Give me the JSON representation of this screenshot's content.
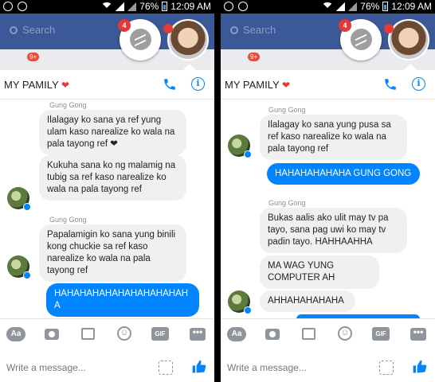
{
  "status": {
    "battery": "76%",
    "time": "12:09 AM"
  },
  "facebook": {
    "search_placeholder": "Search",
    "nav_badge": "9+"
  },
  "chatheads": {
    "messenger_badge": "4"
  },
  "header": {
    "title": "MY PAMILY",
    "heart": "❤"
  },
  "composer": {
    "placeholder": "Write a message...",
    "aa": "Aa",
    "gif": "GIF",
    "more": "•••"
  },
  "left": {
    "messages": [
      {
        "sender": "Gung Gong",
        "text": "Ilalagay ko sana ya ref yung ulam kaso narealize ko wala na pala tayong ref ❤"
      },
      {
        "text": "Kukuha sana ko ng malamig na tubig sa ref kaso narealize ko wala na pala tayong ref"
      },
      {
        "sender": "Gung Gong",
        "text": "Papalamigin ko sana yung binili kong chuckie sa ref kaso narealize ko wala na pala tayong ref"
      },
      {
        "text": "HAHAHAHAHAHAHAHAHAHAHA"
      }
    ]
  },
  "right": {
    "messages": [
      {
        "sender": "Gung Gong",
        "text": "Ilalagay ko sana yung pusa sa ref kaso narealize ko wala na pala tayong ref"
      },
      {
        "text": "HAHAHAHAHAHA GUNG GONG"
      },
      {
        "sender": "Gung Gong",
        "text": "Bukas aalis ako ulit may tv pa tayo, sana pag uwi ko may tv padin tayo. HAHHAAHHA"
      },
      {
        "text": "MA WAG YUNG COMPUTER AH"
      },
      {
        "text": "AHHAHAHAHAHA"
      }
    ]
  },
  "colors": {
    "messenger_blue": "#0084ff",
    "facebook_blue": "#3b5998",
    "incoming_bubble": "#f1f0f0"
  }
}
